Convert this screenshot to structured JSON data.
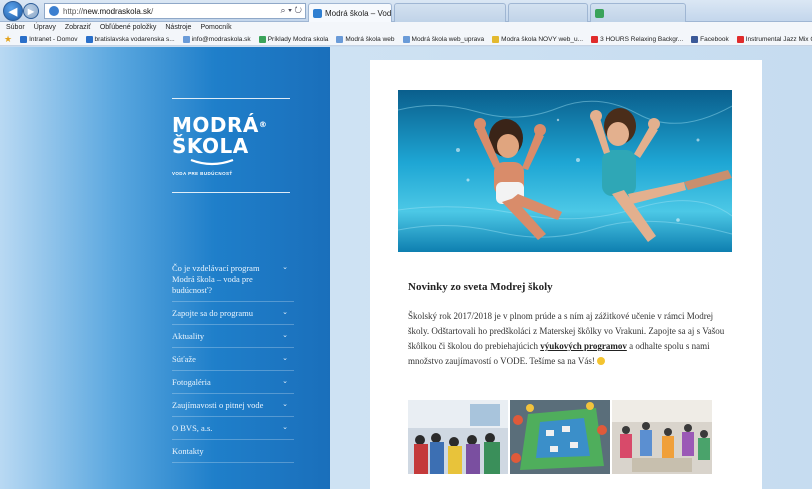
{
  "browser": {
    "url_prefix": "http://",
    "url_host": "new.modraskola.sk",
    "url_suffix": "/",
    "addr_search": "⌕",
    "addr_dropdown": "▾",
    "addr_refresh": "↻",
    "active_tab": "Modrá škola – Voda pre bu...",
    "tab_close": "×"
  },
  "menubar": [
    "Súbor",
    "Úpravy",
    "Zobraziť",
    "Obľúbené položky",
    "Nástroje",
    "Pomocník"
  ],
  "favorites": [
    {
      "label": "Intranet - Domov",
      "color": "#2a6fc9"
    },
    {
      "label": "bratislavska vodarenska s...",
      "color": "#2a6fc9"
    },
    {
      "label": "info@modraskola.sk",
      "color": "#6a9bd8"
    },
    {
      "label": "Príklady Modra skola",
      "color": "#3aa35a"
    },
    {
      "label": "Modrá škola web",
      "color": "#6a9bd8"
    },
    {
      "label": "Modrá škola web_uprava",
      "color": "#6a9bd8"
    },
    {
      "label": "Modra škola NOVY web_u...",
      "color": "#e3b92f"
    },
    {
      "label": "3 HOURS Relaxing Backgr...",
      "color": "#e02b2b"
    },
    {
      "label": "Facebook",
      "color": "#3b5998"
    },
    {
      "label": "Instrumental Jazz Mix Caf...",
      "color": "#e02b2b"
    }
  ],
  "logo": {
    "line1": "MODRÁ",
    "reg": "®",
    "line2": "ŠKOLA",
    "tagline": "VODA PRE BUDÚCNOSŤ"
  },
  "menu": [
    {
      "label": "Čo je vzdelávací program Modrá škola – voda pre budúcnosť?",
      "chevron": true
    },
    {
      "label": "Zapojte sa do programu",
      "chevron": true
    },
    {
      "label": "Aktuality",
      "chevron": true
    },
    {
      "label": "Súťaže",
      "chevron": true
    },
    {
      "label": "Fotogaléria",
      "chevron": true
    },
    {
      "label": "Zaujímavosti o pitnej vode",
      "chevron": true
    },
    {
      "label": "O BVS, a.s.",
      "chevron": true
    },
    {
      "label": "Kontakty",
      "chevron": false
    }
  ],
  "menu_chevron": "⌄",
  "news": {
    "title": "Novinky zo sveta Modrej školy",
    "body_part1": "Školský rok 2017/2018 je v plnom prúde a s ním aj zážitkové učenie v rámci Modrej školy. Odštartovali ho predškoláci z Materskej škôlky vo Vrakuni. Zapojte sa aj s Vašou škôlkou či školou do prebiehajúcich ",
    "link_text": "výukových programov",
    "body_part2": " a odhalte spolu s nami množstvo zaujímavostí o VODE. Tešíme sa na Vás! "
  }
}
